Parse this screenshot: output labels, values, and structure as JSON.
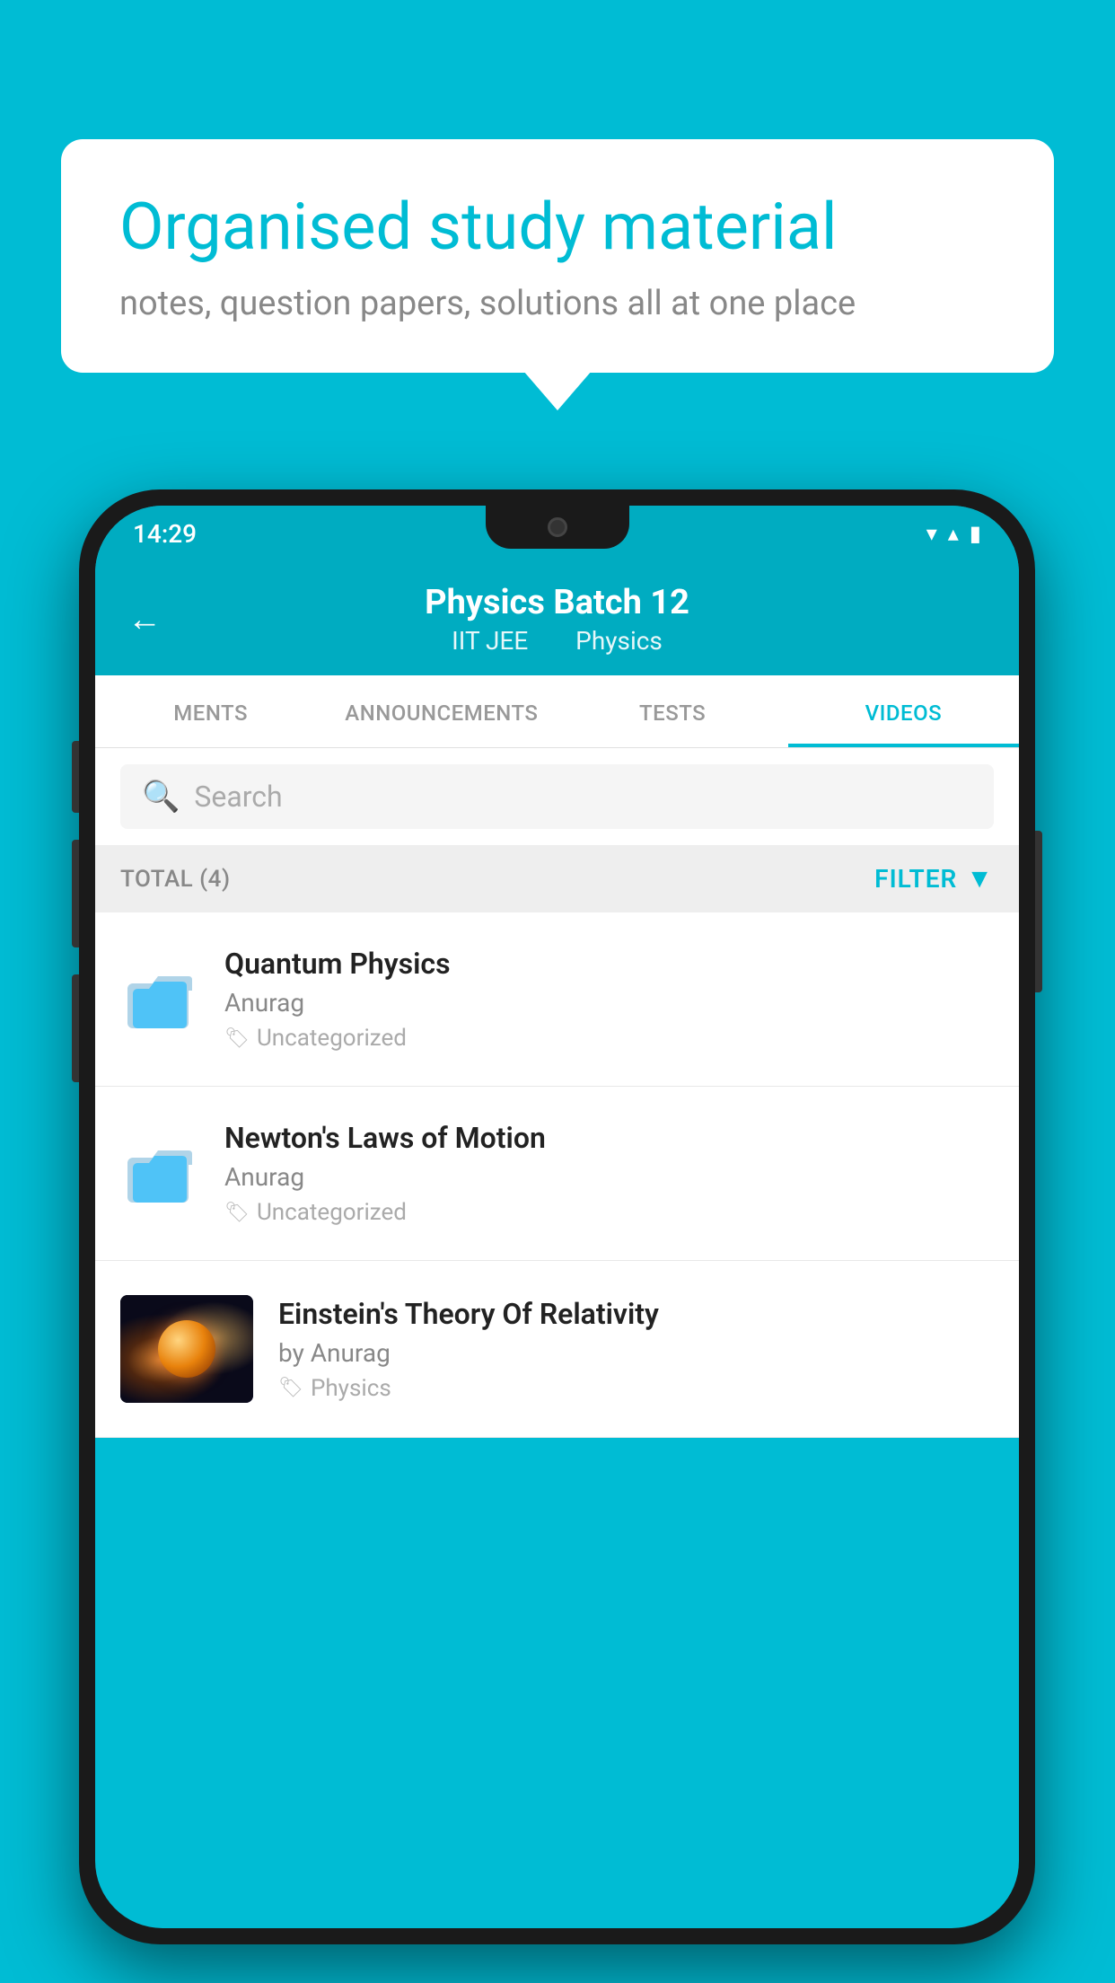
{
  "background_color": "#00BCD4",
  "speech_bubble": {
    "title": "Organised study material",
    "subtitle": "notes, question papers, solutions all at one place"
  },
  "phone": {
    "status_bar": {
      "time": "14:29",
      "icons": [
        "wifi",
        "signal",
        "battery"
      ]
    },
    "header": {
      "back_label": "←",
      "title": "Physics Batch 12",
      "subtitle_part1": "IIT JEE",
      "subtitle_part2": "Physics"
    },
    "tabs": [
      {
        "label": "MENTS",
        "active": false
      },
      {
        "label": "ANNOUNCEMENTS",
        "active": false
      },
      {
        "label": "TESTS",
        "active": false
      },
      {
        "label": "VIDEOS",
        "active": true
      }
    ],
    "search": {
      "placeholder": "Search"
    },
    "filter_row": {
      "total_label": "TOTAL (4)",
      "filter_label": "FILTER"
    },
    "video_list": [
      {
        "title": "Quantum Physics",
        "author": "Anurag",
        "tag": "Uncategorized",
        "has_thumbnail": false,
        "thumbnail_type": "folder"
      },
      {
        "title": "Newton's Laws of Motion",
        "author": "Anurag",
        "tag": "Uncategorized",
        "has_thumbnail": false,
        "thumbnail_type": "folder"
      },
      {
        "title": "Einstein's Theory Of Relativity",
        "author": "by Anurag",
        "tag": "Physics",
        "has_thumbnail": true,
        "thumbnail_type": "video"
      }
    ]
  }
}
